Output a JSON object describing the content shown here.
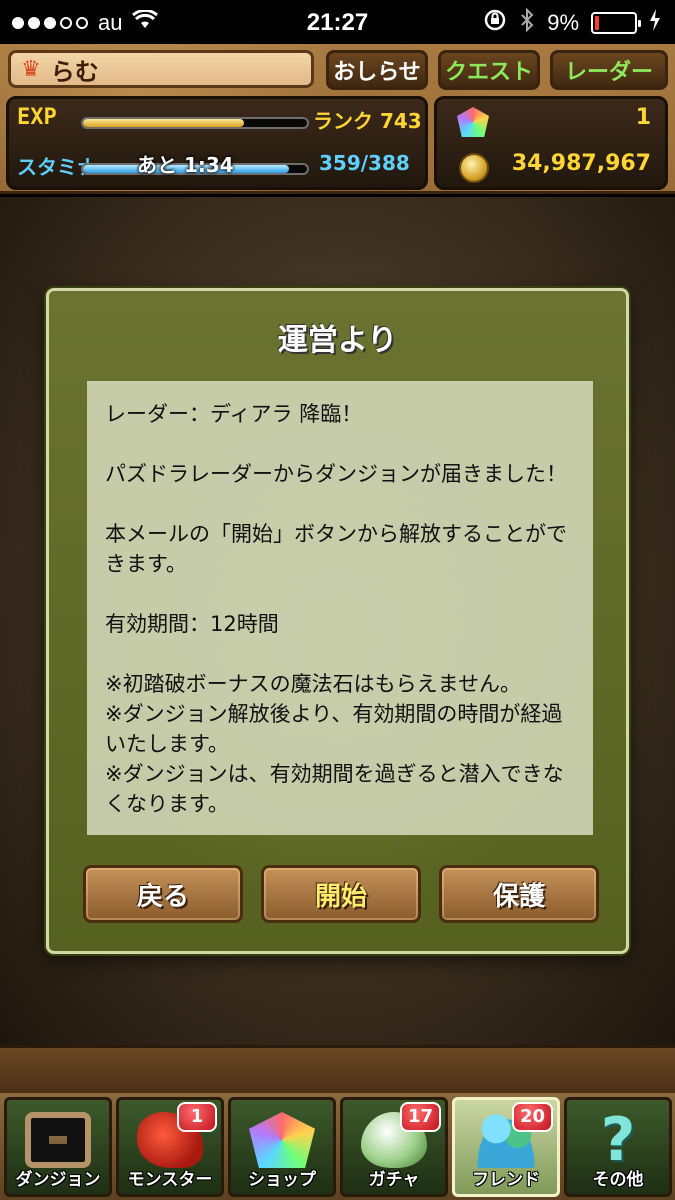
{
  "status_bar": {
    "carrier": "au",
    "time": "21:27",
    "battery": "9%",
    "battery_level": 0.09
  },
  "header": {
    "player_name": "らむ",
    "news_label": "おしらせ",
    "quest_label": "クエスト",
    "radar_label": "レーダー",
    "exp_label": "EXP",
    "exp_progress": 0.72,
    "rank_text": "ランク 743",
    "stamina_label": "スタミナ",
    "stamina_timer": "あと 1:34",
    "stamina_value": "359/388",
    "stamina_progress": 0.92,
    "magic_stones": "1",
    "coins": "34,987,967"
  },
  "dialog": {
    "title": "運営より",
    "message": {
      "line1": "レーダー：ディアラ 降臨！",
      "line2": "パズドラレーダーからダンジョンが届きました！",
      "line3": "本メールの「開始」ボタンから解放することができます。",
      "line4": "有効期間：12時間",
      "note1": "※初踏破ボーナスの魔法石はもらえません。",
      "note2": "※ダンジョン解放後より、有効期間の時間が経過いたします。",
      "note3": "※ダンジョンは、有効期間を過ぎると潜入できなくなります。"
    },
    "back_label": "戻る",
    "start_label": "開始",
    "protect_label": "保護"
  },
  "nav": {
    "items": [
      {
        "label": "ダンジョン",
        "badge": ""
      },
      {
        "label": "モンスター",
        "badge": "1"
      },
      {
        "label": "ショップ",
        "badge": ""
      },
      {
        "label": "ガチャ",
        "badge": "17"
      },
      {
        "label": "フレンド",
        "badge": "20"
      },
      {
        "label": "その他",
        "badge": ""
      }
    ]
  }
}
